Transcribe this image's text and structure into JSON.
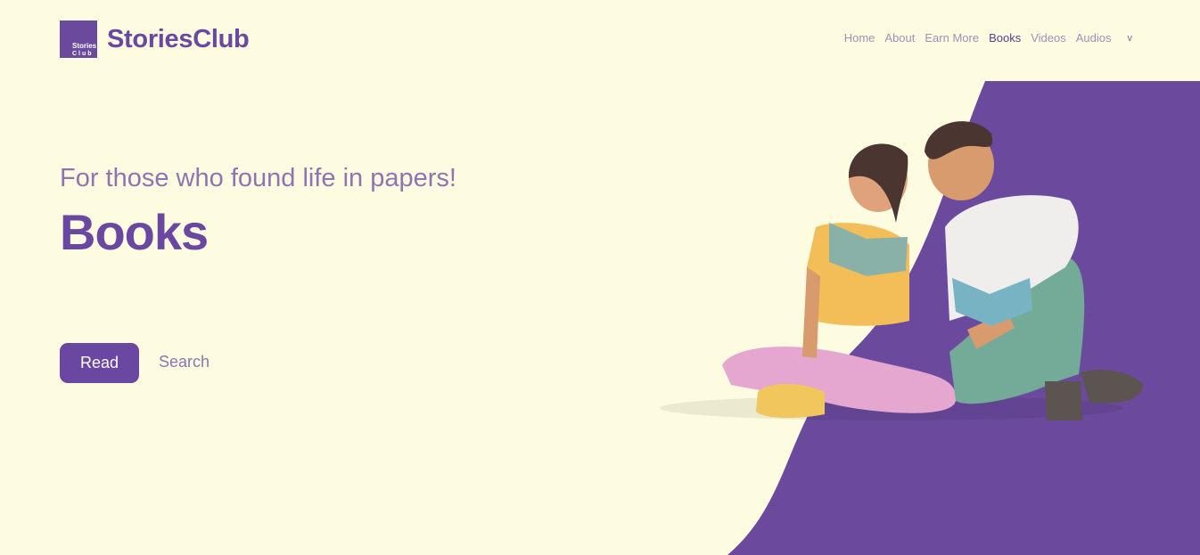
{
  "brand": {
    "logo_line1": "Stories",
    "logo_line2": "Club",
    "name": "StoriesClub"
  },
  "nav": {
    "items": [
      "Home",
      "About",
      "Earn More",
      "Books",
      "Videos",
      "Audios"
    ],
    "active": "Books",
    "more_label": "v"
  },
  "hero": {
    "subtitle": "For those who found life in papers!",
    "title": "Books",
    "read_button": "Read",
    "search_link": "Search"
  },
  "colors": {
    "accent": "#6a47a0",
    "background": "#fdfbe0"
  }
}
